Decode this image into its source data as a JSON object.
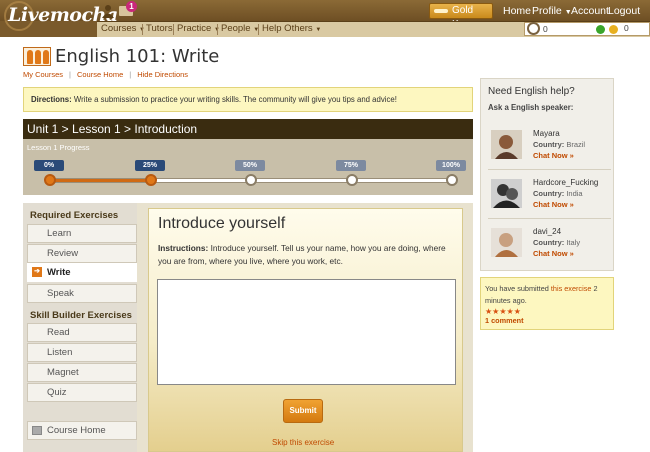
{
  "header": {
    "logo_text": "Livemocha",
    "mail_badge": "1",
    "goldkey_label": "Gold Key",
    "nav": [
      {
        "label": "Home",
        "caret": false
      },
      {
        "label": "Profile",
        "caret": true
      },
      {
        "label": "Account",
        "caret": false
      },
      {
        "label": "Logout",
        "caret": false
      }
    ],
    "subnav": [
      {
        "label": "Courses",
        "caret": true
      },
      {
        "label": "Tutors",
        "caret": false
      },
      {
        "label": "Practice",
        "caret": true
      },
      {
        "label": "People",
        "caret": true
      },
      {
        "label": "Help Others",
        "caret": true
      }
    ],
    "points_value": "0",
    "status_count": "0",
    "status_colors": [
      "#3aa52a",
      "#e8b020"
    ]
  },
  "page": {
    "title": "English 101: Write",
    "sublinks": [
      "My Courses",
      "Course Home",
      "Hide Directions"
    ],
    "directions_label": "Directions:",
    "directions_text": "Write a submission to practice your writing skills. The community will give you tips and advice!"
  },
  "unit": {
    "breadcrumb": "Unit 1 > Lesson 1 > Introduction",
    "progress_label": "Lesson 1 Progress",
    "progress": 0.25,
    "markers": [
      {
        "label": "0%",
        "color": "#2a4a78"
      },
      {
        "label": "25%",
        "color": "#2a4a78"
      },
      {
        "label": "50%",
        "color": "#7d8aa0"
      },
      {
        "label": "75%",
        "color": "#7d8aa0"
      },
      {
        "label": "100%",
        "color": "#7d8aa0"
      }
    ]
  },
  "leftnav": {
    "required_heading": "Required Exercises",
    "required": [
      {
        "label": "Learn",
        "active": false
      },
      {
        "label": "Review",
        "active": false
      },
      {
        "label": "Write",
        "active": true
      },
      {
        "label": "Speak",
        "active": false
      }
    ],
    "builder_heading": "Skill Builder Exercises",
    "builder": [
      {
        "label": "Read"
      },
      {
        "label": "Listen"
      },
      {
        "label": "Magnet"
      },
      {
        "label": "Quiz"
      }
    ],
    "course_home": "Course Home"
  },
  "exercise": {
    "title": "Introduce yourself",
    "instructions_label": "Instructions:",
    "instructions_text": "Introduce yourself. Tell us your name, how you are doing, where you are from, where you live, where you work, etc.",
    "answer_value": "",
    "submit_label": "Submit",
    "skip_label": "Skip this exercise"
  },
  "help": {
    "title": "Need English help?",
    "subtitle": "Ask a English speaker:",
    "country_label": "Country:",
    "chat_label": "Chat Now »",
    "speakers": [
      {
        "name": "Mayara",
        "country": "Brazil"
      },
      {
        "name": "Hardcore_Fucking",
        "country": "India"
      },
      {
        "name": "davi_24",
        "country": "Italy"
      }
    ]
  },
  "submission": {
    "text_before": "You have submitted ",
    "link_text": "this exercise",
    "text_after": " 2 minutes ago.",
    "rating": 5,
    "stars": "★★★★★",
    "comments": "1 comment"
  }
}
